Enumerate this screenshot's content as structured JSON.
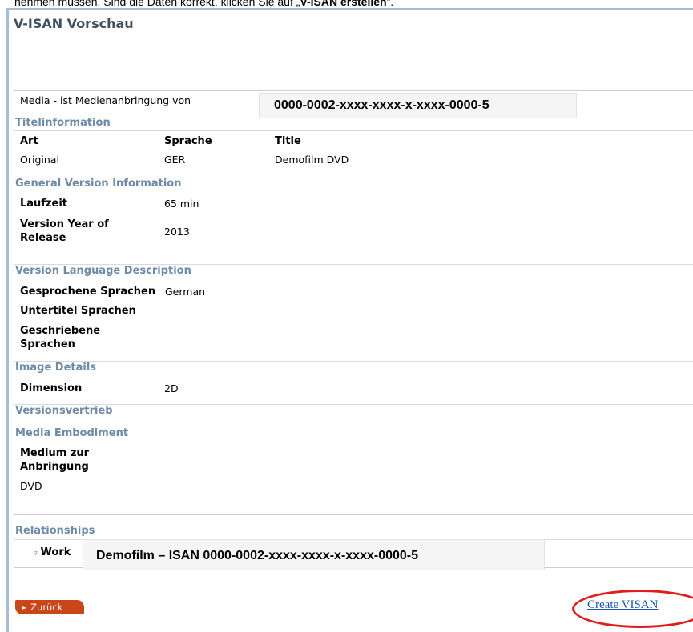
{
  "instruction_text": {
    "prefix": "nehmen müssen. Sind die Daten korrekt, klicken Sie auf „",
    "bold": "V-ISAN erstellen",
    "suffix": "“."
  },
  "page_title": "V-ISAN Vorschau",
  "media_label": "Media - ist Medienanbringung von",
  "isan_callout": "0000-0002-xxxx-xxxx-x-xxxx-0000-5",
  "sections": {
    "titelinformation": "Titelinformation",
    "general_version": "General Version Information",
    "version_language": "Version Language Description",
    "image_details": "Image Details",
    "versionsvertrieb": "Versionsvertrieb",
    "media_embodiment": "Media Embodiment",
    "relationships": "Relationships"
  },
  "title_table": {
    "headers": [
      "Art",
      "Sprache",
      "Title"
    ],
    "row": [
      "Original",
      "GER",
      "Demofilm DVD"
    ]
  },
  "general": {
    "laufzeit_label": "Laufzeit",
    "laufzeit_value": "65 min",
    "year_label_1": "Version Year of",
    "year_label_2": "Release",
    "year_value": "2013"
  },
  "language": {
    "spoken_label": "Gesprochene Sprachen",
    "spoken_value": "German",
    "subtitle_label": "Untertitel Sprachen",
    "written_label_1": "Geschriebene",
    "written_label_2": "Sprachen"
  },
  "image": {
    "dimension_label": "Dimension",
    "dimension_value": "2D"
  },
  "media": {
    "medium_label_1": "Medium zur",
    "medium_label_2": "Anbringung",
    "medium_value": "DVD"
  },
  "relationship": {
    "work_label": "Work",
    "work_callout": "Demofilm – ISAN 0000-0002-xxxx-xxxx-x-xxxx-0000-5"
  },
  "buttons": {
    "back": "Zurück",
    "create": "Create VISAN"
  },
  "colors": {
    "section_heading": "#6d8aa8",
    "back_button": "#c8461a",
    "highlight_oval": "#e01c1c",
    "link": "#1a56b3"
  }
}
